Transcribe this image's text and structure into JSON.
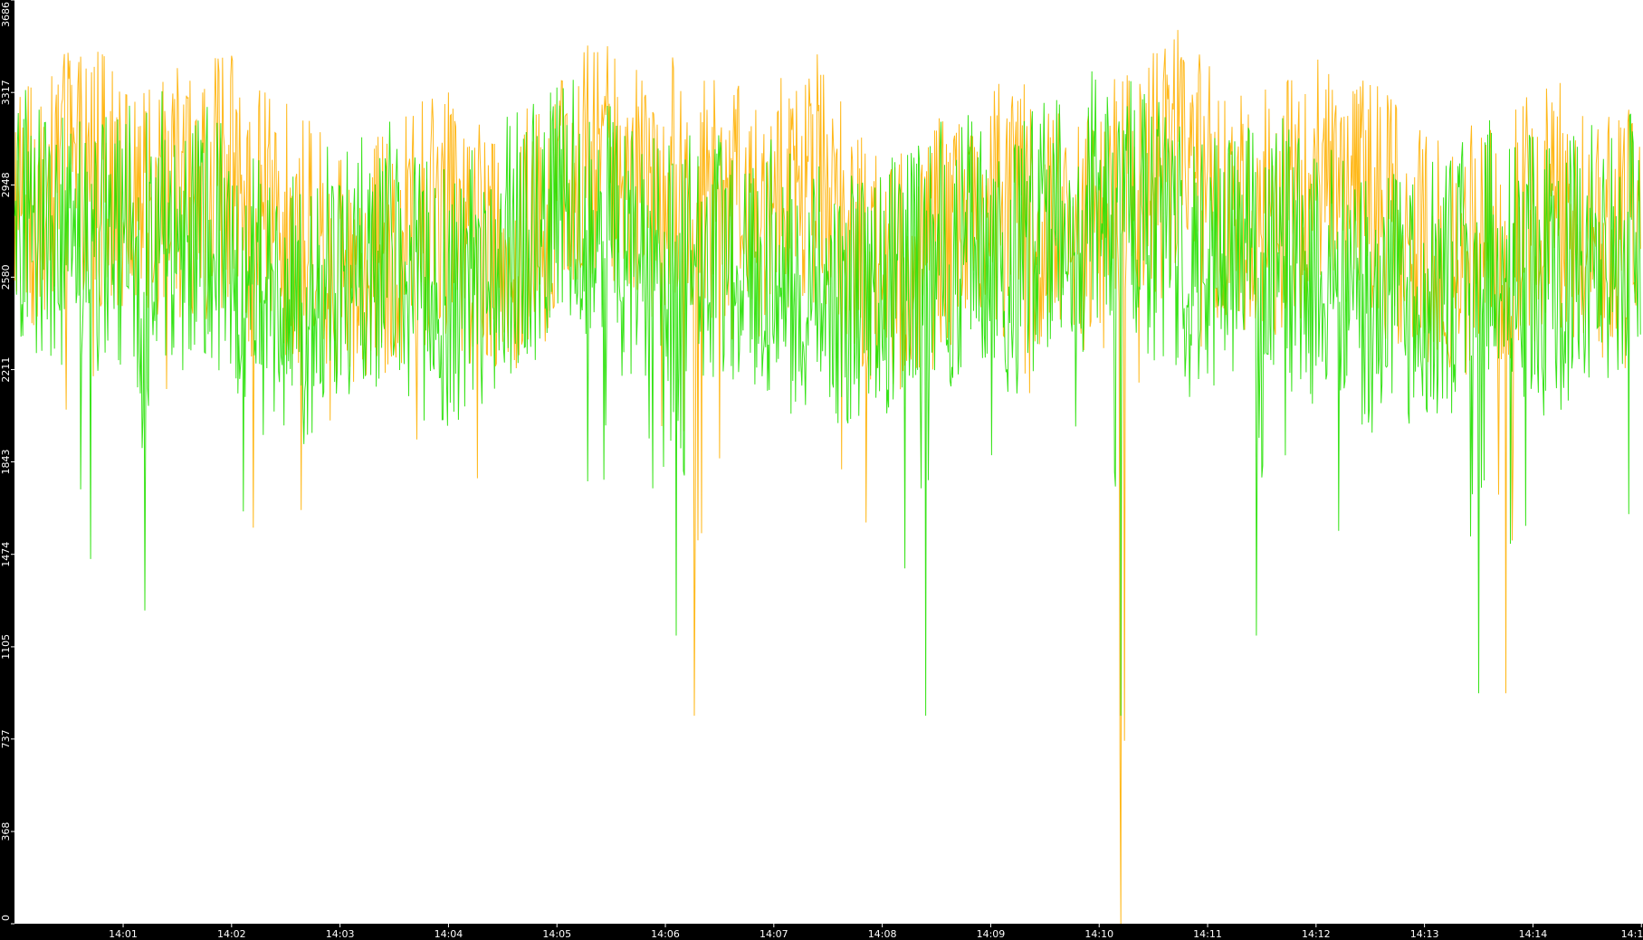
{
  "chart_data": {
    "type": "line",
    "title": "",
    "xlabel": "",
    "ylabel": "",
    "ylim": [
      0,
      3686
    ],
    "y_ticks": [
      "0",
      "368",
      "737",
      "1105",
      "1474",
      "1843",
      "2211",
      "2580",
      "2948",
      "3317",
      "3686"
    ],
    "x_tick_labels": [
      "14:01",
      "14:02",
      "14:03",
      "14:04",
      "14:05",
      "14:06",
      "14:07",
      "14:08",
      "14:09",
      "14:10",
      "14:11",
      "14:12",
      "14:13",
      "14:14",
      "14:1"
    ],
    "x_range_minutes": [
      0,
      15
    ],
    "grid": false,
    "legend": "none",
    "background_color": "#ffffff",
    "axis_color": "#000000",
    "series": [
      {
        "color": "#ffb000",
        "typical_range": [
          2400,
          3350
        ],
        "mean": 2850,
        "notable_dips": [
          {
            "minute": 2.2,
            "value": 1580
          },
          {
            "minute": 6.27,
            "value": 830
          },
          {
            "minute": 10.2,
            "value": 0
          },
          {
            "minute": 13.75,
            "value": 920
          }
        ]
      },
      {
        "color": "#22e000",
        "typical_range": [
          2100,
          3100
        ],
        "mean": 2650,
        "notable_dips": [
          {
            "minute": 1.2,
            "value": 1250
          },
          {
            "minute": 6.1,
            "value": 1150
          },
          {
            "minute": 8.4,
            "value": 830
          },
          {
            "minute": 10.2,
            "value": 830
          },
          {
            "minute": 11.45,
            "value": 1150
          },
          {
            "minute": 13.5,
            "value": 920
          }
        ]
      }
    ]
  }
}
